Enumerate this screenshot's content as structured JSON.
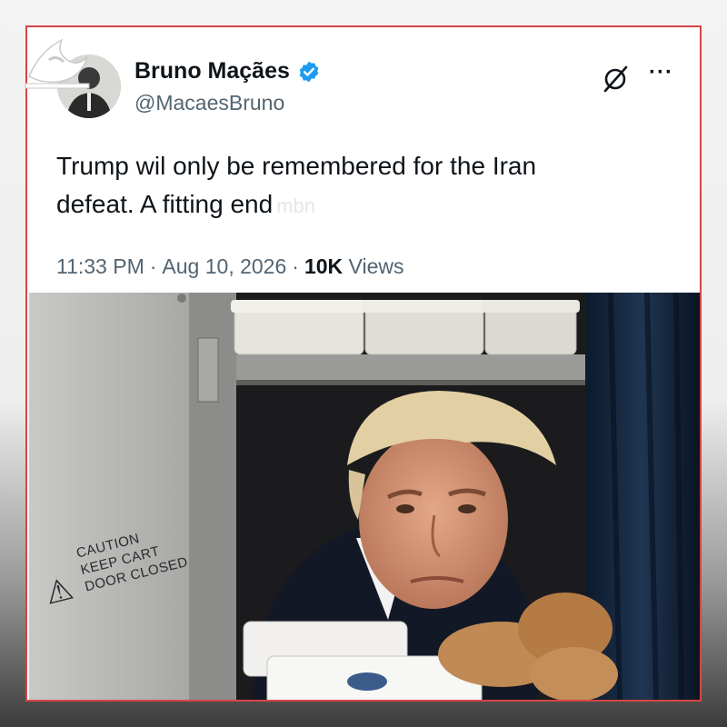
{
  "tweet": {
    "display_name": "Bruno Maçães",
    "handle": "@MacaesBruno",
    "text_line1": "Trump wil only be remembered for the Iran",
    "text_line2": "defeat. A fitting end",
    "watermark": "mbn",
    "time": "11:33 PM",
    "separator1": "·",
    "date": "Aug 10, 2026",
    "separator2": "·",
    "views_count": "10K",
    "views_label": "Views"
  },
  "icons": {
    "verified": "verified-badge-icon",
    "grok": "grok-icon",
    "more": "more-options-icon",
    "channel_logo": "channel-logo"
  },
  "photo": {
    "caution_line1": "CAUTION",
    "caution_line2": "KEEP CART",
    "caution_line3": "DOOR CLOSED",
    "warning_symbol": "!"
  },
  "colors": {
    "border_accent": "#d64545",
    "verified_blue": "#1d9bf0",
    "text_primary": "#0f1419",
    "text_secondary": "#536471"
  }
}
